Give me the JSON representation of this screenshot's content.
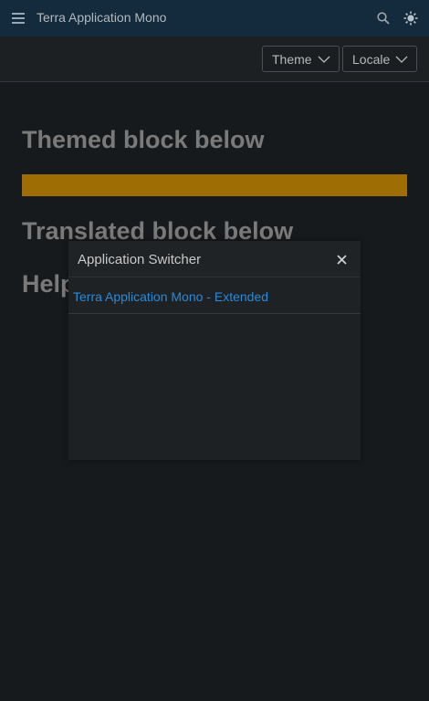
{
  "header": {
    "app_title": "Terra Application Mono",
    "menu_icon": "menu-icon",
    "search_icon": "search-icon",
    "settings_icon": "sun-icon"
  },
  "toolbar": {
    "theme_label": "Theme",
    "locale_label": "Locale"
  },
  "main": {
    "themed_heading": "Themed block below",
    "translated_heading": "Translated block below",
    "help_heading": "Help"
  },
  "popup": {
    "title": "Application Switcher",
    "items": [
      {
        "label": "Terra Application Mono - Extended"
      }
    ]
  },
  "colors": {
    "header_bg": "#132b3d",
    "page_bg": "#171a1d",
    "themed_bar": "#9e6e04",
    "link": "#2b8ad6"
  }
}
